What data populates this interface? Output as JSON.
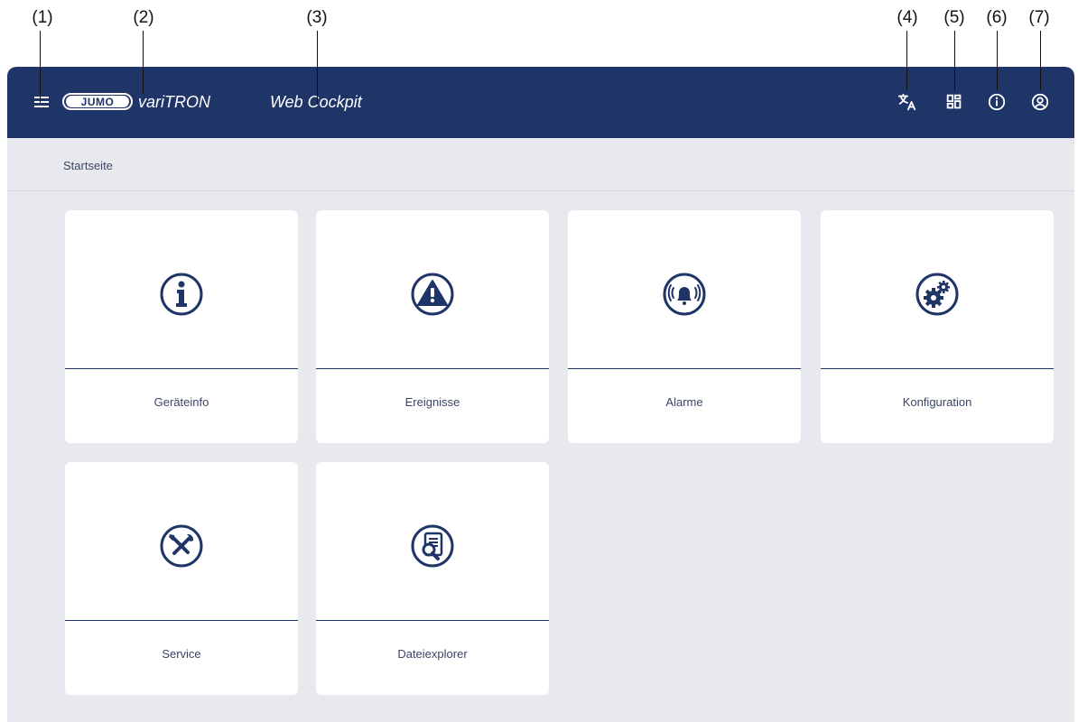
{
  "callouts": [
    "(1)",
    "(2)",
    "(3)",
    "(4)",
    "(5)",
    "(6)",
    "(7)"
  ],
  "header": {
    "logo_text": "JUMO",
    "brand_name": "variTRON",
    "app_title": "Web Cockpit",
    "background_color": "#1f3467",
    "icons": [
      "menu-icon",
      "translate-icon",
      "dashboard-icon",
      "info-icon",
      "account-icon"
    ]
  },
  "breadcrumb": {
    "current": "Startseite"
  },
  "tiles": [
    {
      "label": "Geräteinfo",
      "icon": "info-icon"
    },
    {
      "label": "Ereignisse",
      "icon": "warning-icon"
    },
    {
      "label": "Alarme",
      "icon": "alarm-bell-icon"
    },
    {
      "label": "Konfiguration",
      "icon": "gears-icon"
    },
    {
      "label": "Service",
      "icon": "tools-icon"
    },
    {
      "label": "Dateiexplorer",
      "icon": "file-search-icon"
    }
  ],
  "colors": {
    "accent": "#1f3467",
    "background": "#e7e9ee",
    "tile": "#ffffff"
  }
}
